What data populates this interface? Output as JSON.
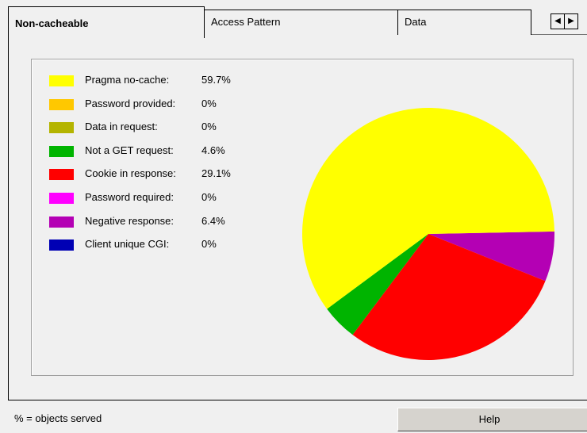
{
  "tabs": [
    {
      "label": "Non-cacheable",
      "active": true
    },
    {
      "label": "Access Pattern",
      "active": false
    },
    {
      "label": "Data",
      "active": false
    }
  ],
  "scroll": {
    "left_icon": "arrow-left-icon",
    "right_icon": "arrow-right-icon"
  },
  "chart_data": {
    "type": "pie",
    "title": "",
    "slices": [
      {
        "label": "Pragma no-cache:",
        "value": 59.7,
        "display": "59.7%",
        "color": "#ffff00"
      },
      {
        "label": "Password provided:",
        "value": 0,
        "display": "0%",
        "color": "#ffc800"
      },
      {
        "label": "Data in request:",
        "value": 0,
        "display": "0%",
        "color": "#b4b400"
      },
      {
        "label": "Not a GET request:",
        "value": 4.6,
        "display": "4.6%",
        "color": "#00b400"
      },
      {
        "label": "Cookie in response:",
        "value": 29.1,
        "display": "29.1%",
        "color": "#ff0000"
      },
      {
        "label": "Password required:",
        "value": 0,
        "display": "0%",
        "color": "#ff00ff"
      },
      {
        "label": "Negative response:",
        "value": 6.4,
        "display": "6.4%",
        "color": "#b400b4"
      },
      {
        "label": "Client unique CGI:",
        "value": 0,
        "display": "0%",
        "color": "#0000b4"
      }
    ],
    "legend_position": "left"
  },
  "status": {
    "text": "% = objects served"
  },
  "help": {
    "label": "Help"
  }
}
